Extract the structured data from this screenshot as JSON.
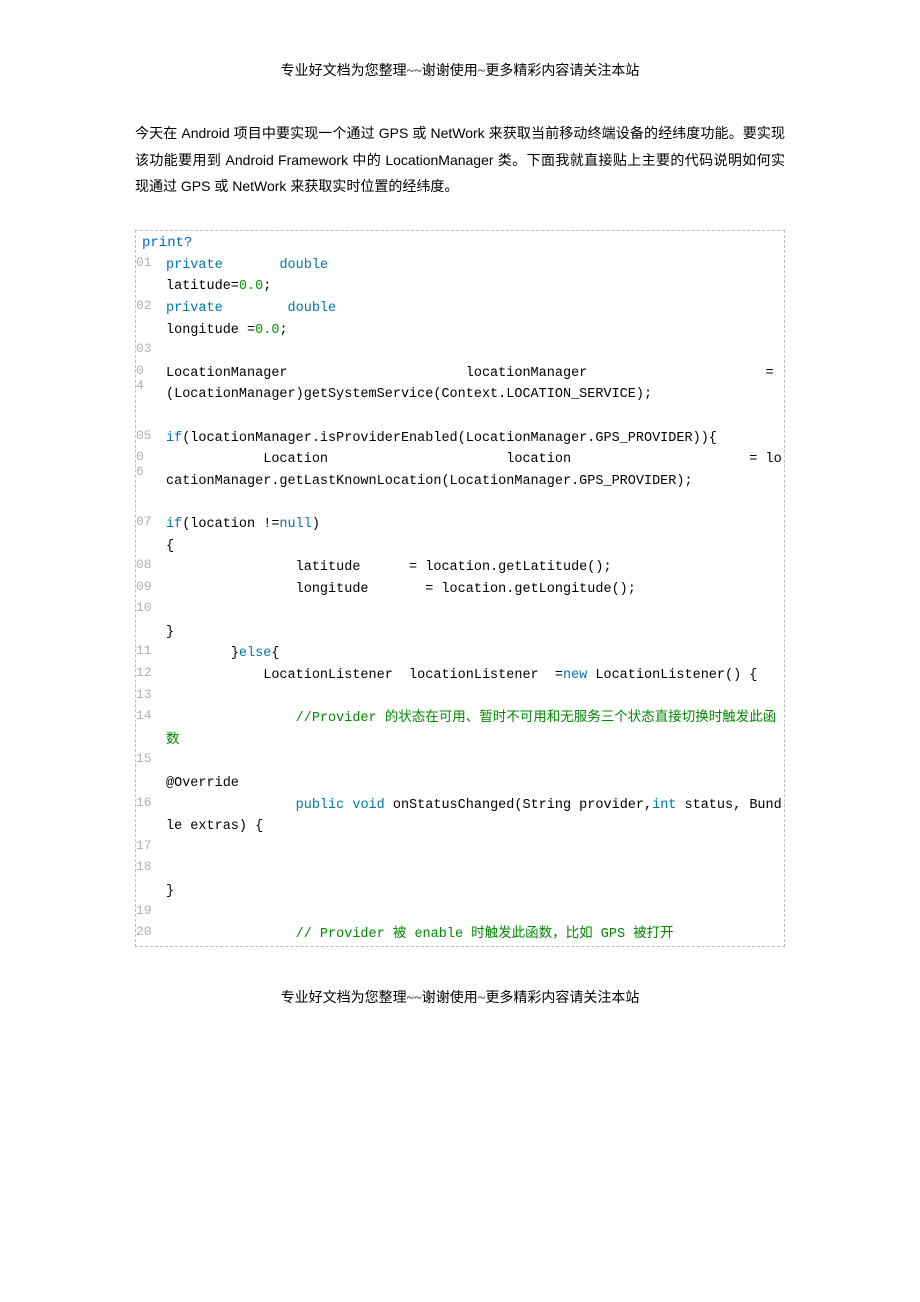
{
  "header": "专业好文档为您整理~~谢谢使用~更多精彩内容请关注本站",
  "footer": "专业好文档为您整理~~谢谢使用~更多精彩内容请关注本站",
  "intro": "今天在 Android 项目中要实现一个通过 GPS 或 NetWork 来获取当前移动终端设备的经纬度功能。要实现该功能要用到 Android Framework 中的 LocationManager 类。下面我就直接贴上主要的代码说明如何实现通过 GPS 或 NetWork 来获取实时位置的经纬度。",
  "print_label": "print?",
  "lines": {
    "l01": "01",
    "l02": "02",
    "l03": "03",
    "l04": "0\n4",
    "l05": "05",
    "l06": "0\n6",
    "l07": "07",
    "l08": "08",
    "l09": "09",
    "l10": "10",
    "l11": "11",
    "l12": "12",
    "l13": "13",
    "l14": "14",
    "l15": "15",
    "l16": "16",
    "l17": "17",
    "l18": "18",
    "l19": "19",
    "l20": "20"
  },
  "c": {
    "private": "private",
    "double": "double",
    "lat_decl": "latitude=",
    "zero": "0.0",
    "semi": ";",
    "lon_decl": "longitude =",
    "l04": "LocationManager                      locationManager                      = (LocationManager)getSystemService(Context.LOCATION_SERVICE);",
    "if": "if",
    "l05_body": "(locationManager.isProviderEnabled(LocationManager.GPS_PROVIDER)){",
    "l06": "            Location                      location                      = locationManager.getLastKnownLocation(LocationManager.GPS_PROVIDER);",
    "l07_a": "(location !=",
    "null": "null",
    "l07_b": ")\n{",
    "l08": "                latitude      = location.getLatitude();",
    "l09": "                longitude       = location.getLongitude();",
    "l10": "            \n}",
    "l11_a": "        }",
    "else": "else",
    "l11_b": "{",
    "l12_a": "            LocationListener  locationListener  =",
    "new": "new",
    "l12_b": " LocationListener() {",
    "l13": "                 ",
    "l14_a": "                ",
    "l14_cm": "//Provider 的状态在可用、暂时不可用和无服务三个状态直接切换时触发此函数",
    "l15": "                \n@Override",
    "l16_a": "                ",
    "public": "public",
    "void": "void",
    "l16_b": " onStatusChanged(String provider,",
    "int": "int",
    "l16_c": " status, Bundle extras) {",
    "l17": "                     ",
    "l18": "                \n}",
    "l19": "                 ",
    "l20_a": "                ",
    "l20_cm": "// Provider 被 enable 时触发此函数，比如 GPS 被打开"
  }
}
